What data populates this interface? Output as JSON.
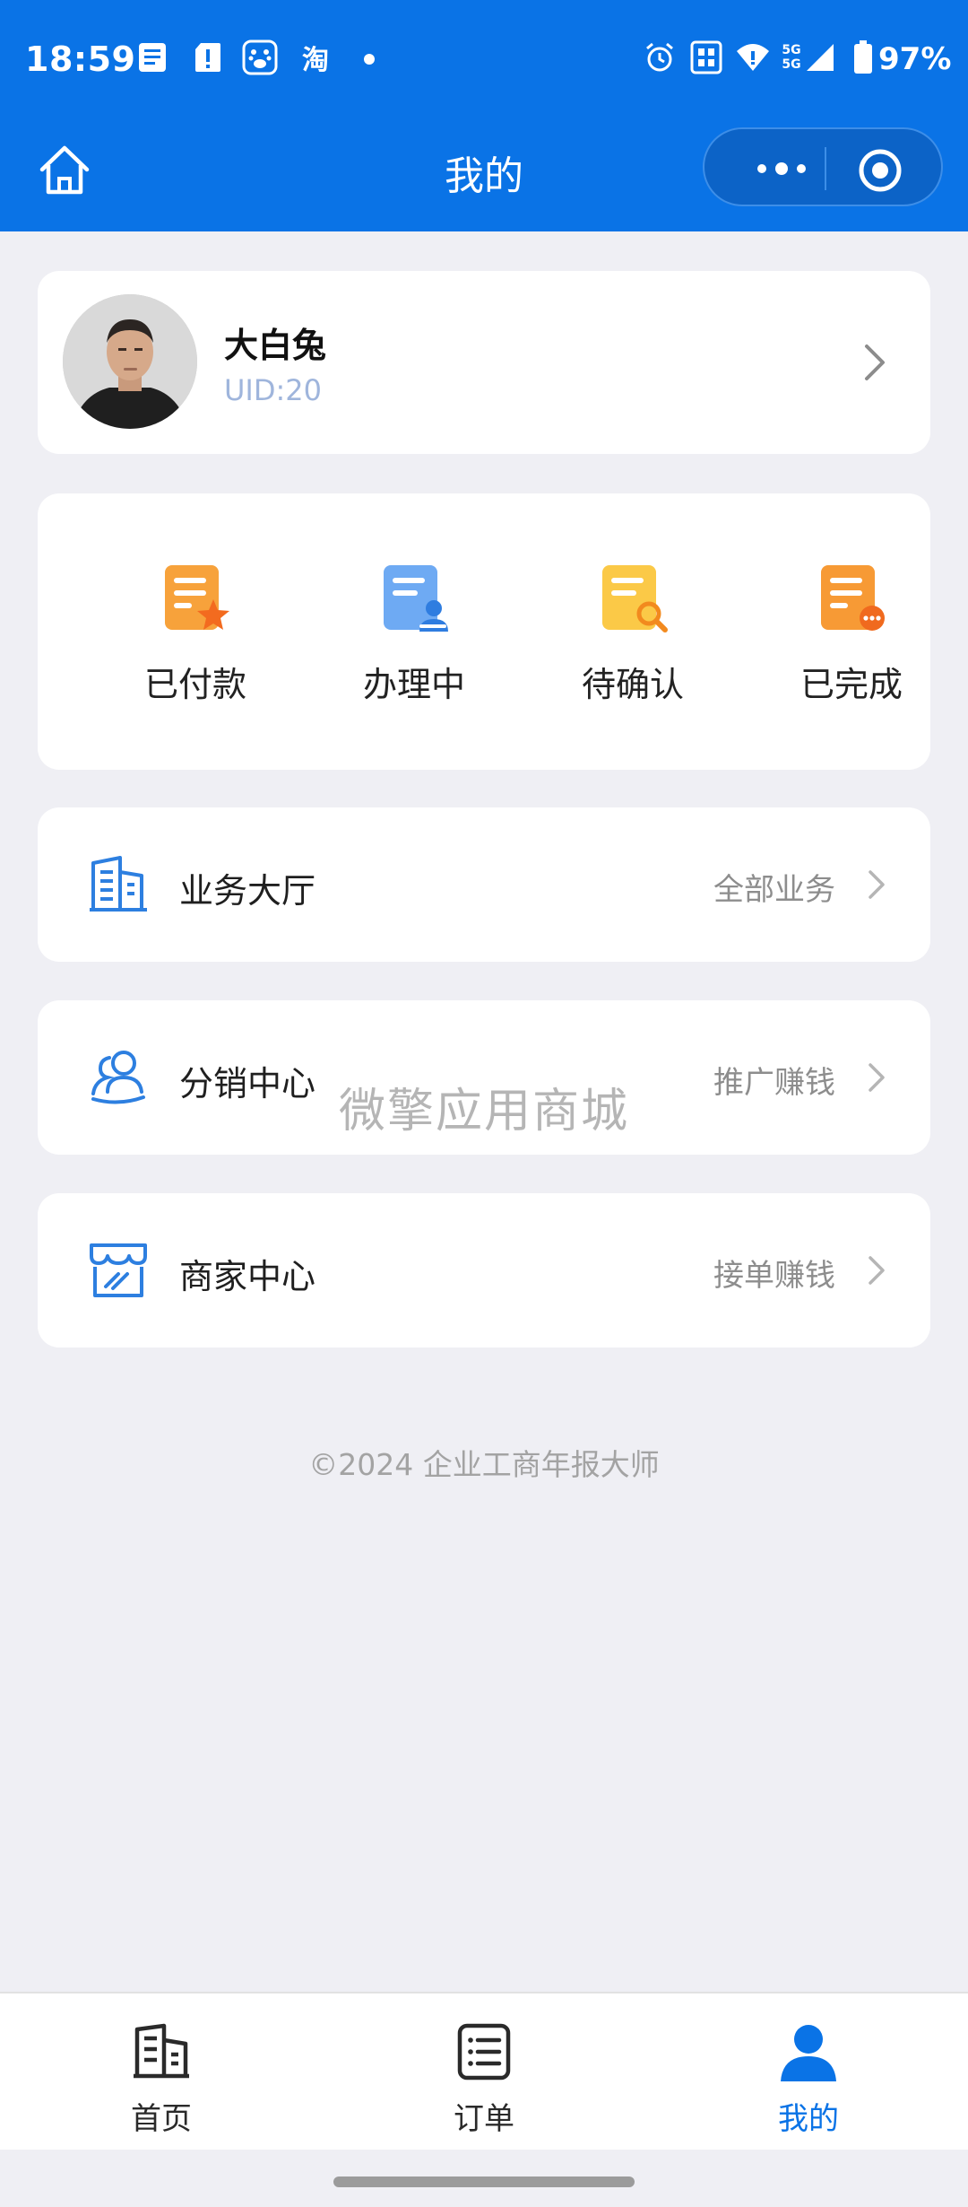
{
  "status_bar": {
    "time": "18:59",
    "notif_icons": [
      "doc-icon",
      "alert-icon",
      "baidu-paw-icon",
      "taobao-icon"
    ],
    "taobao_glyph": "淘",
    "signal_label": "5G",
    "battery": "97%"
  },
  "nav": {
    "title": "我的"
  },
  "profile": {
    "name": "大白兔",
    "uid": "UID:20"
  },
  "orders": [
    {
      "label": "已付款",
      "icon": "paid-doc-icon",
      "color": "#f7a23b"
    },
    {
      "label": "办理中",
      "icon": "processing-doc-icon",
      "color": "#5aa0f2"
    },
    {
      "label": "待确认",
      "icon": "pending-doc-icon",
      "color": "#f9c54a"
    },
    {
      "label": "已完成",
      "icon": "completed-doc-icon",
      "color": "#f79a35"
    }
  ],
  "menu": [
    {
      "label": "业务大厅",
      "right": "全部业务",
      "icon": "building-icon"
    },
    {
      "label": "分销中心",
      "right": "推广赚钱",
      "icon": "users-icon"
    },
    {
      "label": "商家中心",
      "right": "接单赚钱",
      "icon": "store-icon"
    }
  ],
  "watermark": "微擎应用商城",
  "copyright": "©2024 企业工商年报大师",
  "tabs": [
    {
      "label": "首页",
      "icon": "home-building-icon",
      "active": false
    },
    {
      "label": "订单",
      "icon": "order-list-icon",
      "active": false
    },
    {
      "label": "我的",
      "icon": "profile-icon",
      "active": true
    }
  ],
  "colors": {
    "primary": "#0a73e6",
    "background": "#efeff4"
  }
}
